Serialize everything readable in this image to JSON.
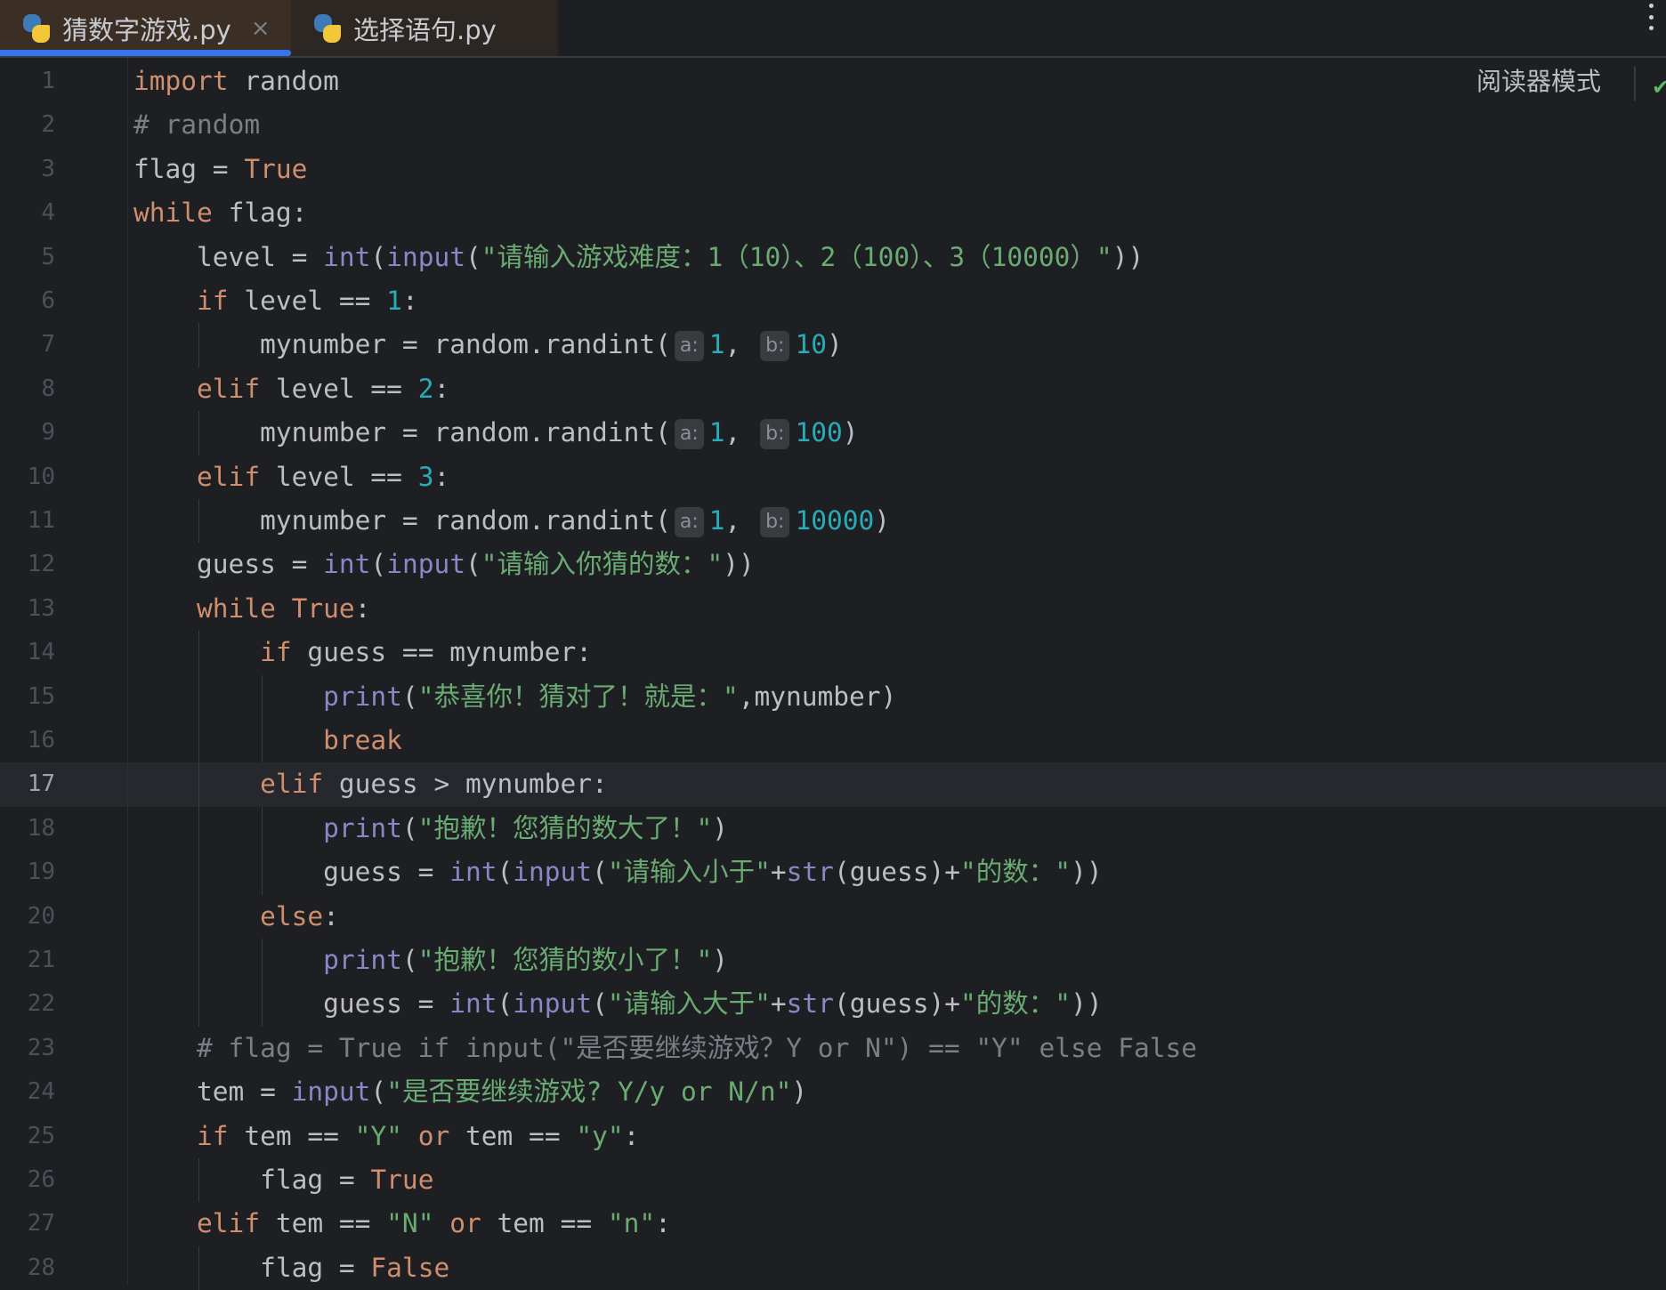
{
  "tabs": [
    {
      "label": "猜数字游戏.py",
      "active": true,
      "close": "×"
    },
    {
      "label": "选择语句.py",
      "active": false
    }
  ],
  "reader_mode": "阅读器模式",
  "current_line": 17,
  "colors": {
    "accent": "#3574F0",
    "keyword": "#CF8E6D",
    "builtin": "#8888C6",
    "string": "#6AAB73",
    "number": "#2AACB8",
    "comment": "#7A7E85"
  },
  "lines": [
    {
      "n": "1",
      "indent": 0,
      "tokens": [
        [
          "kw",
          "import"
        ],
        [
          "tx",
          " random"
        ]
      ]
    },
    {
      "n": "2",
      "indent": 0,
      "tokens": [
        [
          "cm",
          "# random"
        ]
      ]
    },
    {
      "n": "3",
      "indent": 0,
      "tokens": [
        [
          "tx",
          "flag = "
        ],
        [
          "kw",
          "True"
        ]
      ]
    },
    {
      "n": "4",
      "indent": 0,
      "tokens": [
        [
          "kw",
          "while"
        ],
        [
          "tx",
          " flag:"
        ]
      ]
    },
    {
      "n": "5",
      "indent": 1,
      "tokens": [
        [
          "tx",
          "level = "
        ],
        [
          "bi",
          "int"
        ],
        [
          "tx",
          "("
        ],
        [
          "bi",
          "input"
        ],
        [
          "tx",
          "("
        ],
        [
          "str",
          "\"请输入游戏难度：1（10）、2（100）、3（10000）\""
        ],
        [
          "tx",
          "))"
        ]
      ]
    },
    {
      "n": "6",
      "indent": 1,
      "tokens": [
        [
          "kw",
          "if"
        ],
        [
          "tx",
          " level == "
        ],
        [
          "num",
          "1"
        ],
        [
          "tx",
          ":"
        ]
      ]
    },
    {
      "n": "7",
      "indent": 2,
      "tokens": [
        [
          "tx",
          "mynumber = random.randint("
        ],
        [
          "hint",
          "a:"
        ],
        [
          "num",
          "1"
        ],
        [
          "tx",
          ", "
        ],
        [
          "hint",
          "b:"
        ],
        [
          "num",
          "10"
        ],
        [
          "tx",
          ")"
        ]
      ]
    },
    {
      "n": "8",
      "indent": 1,
      "tokens": [
        [
          "kw",
          "elif"
        ],
        [
          "tx",
          " level == "
        ],
        [
          "num",
          "2"
        ],
        [
          "tx",
          ":"
        ]
      ]
    },
    {
      "n": "9",
      "indent": 2,
      "tokens": [
        [
          "tx",
          "mynumber = random.randint("
        ],
        [
          "hint",
          "a:"
        ],
        [
          "num",
          "1"
        ],
        [
          "tx",
          ", "
        ],
        [
          "hint",
          "b:"
        ],
        [
          "num",
          "100"
        ],
        [
          "tx",
          ")"
        ]
      ]
    },
    {
      "n": "10",
      "indent": 1,
      "tokens": [
        [
          "kw",
          "elif"
        ],
        [
          "tx",
          " level == "
        ],
        [
          "num",
          "3"
        ],
        [
          "tx",
          ":"
        ]
      ]
    },
    {
      "n": "11",
      "indent": 2,
      "tokens": [
        [
          "tx",
          "mynumber = random.randint("
        ],
        [
          "hint",
          "a:"
        ],
        [
          "num",
          "1"
        ],
        [
          "tx",
          ", "
        ],
        [
          "hint",
          "b:"
        ],
        [
          "num",
          "10000"
        ],
        [
          "tx",
          ")"
        ]
      ]
    },
    {
      "n": "12",
      "indent": 1,
      "tokens": [
        [
          "tx",
          "guess = "
        ],
        [
          "bi",
          "int"
        ],
        [
          "tx",
          "("
        ],
        [
          "bi",
          "input"
        ],
        [
          "tx",
          "("
        ],
        [
          "str",
          "\"请输入你猜的数：\""
        ],
        [
          "tx",
          "))"
        ]
      ]
    },
    {
      "n": "13",
      "indent": 1,
      "tokens": [
        [
          "kw",
          "while"
        ],
        [
          "tx",
          " "
        ],
        [
          "kw",
          "True"
        ],
        [
          "tx",
          ":"
        ]
      ]
    },
    {
      "n": "14",
      "indent": 2,
      "tokens": [
        [
          "kw",
          "if"
        ],
        [
          "tx",
          " guess == mynumber:"
        ]
      ]
    },
    {
      "n": "15",
      "indent": 3,
      "tokens": [
        [
          "bi",
          "print"
        ],
        [
          "tx",
          "("
        ],
        [
          "str",
          "\"恭喜你！猜对了！就是：\""
        ],
        [
          "tx",
          ",mynumber)"
        ]
      ]
    },
    {
      "n": "16",
      "indent": 3,
      "tokens": [
        [
          "kw",
          "break"
        ]
      ]
    },
    {
      "n": "17",
      "indent": 2,
      "tokens": [
        [
          "kw",
          "elif"
        ],
        [
          "tx",
          " guess > mynumber:"
        ]
      ]
    },
    {
      "n": "18",
      "indent": 3,
      "tokens": [
        [
          "bi",
          "print"
        ],
        [
          "tx",
          "("
        ],
        [
          "str",
          "\"抱歉！您猜的数大了！\""
        ],
        [
          "tx",
          ")"
        ]
      ]
    },
    {
      "n": "19",
      "indent": 3,
      "tokens": [
        [
          "tx",
          "guess = "
        ],
        [
          "bi",
          "int"
        ],
        [
          "tx",
          "("
        ],
        [
          "bi",
          "input"
        ],
        [
          "tx",
          "("
        ],
        [
          "str",
          "\"请输入小于\""
        ],
        [
          "tx",
          "+"
        ],
        [
          "bi",
          "str"
        ],
        [
          "tx",
          "(guess)+"
        ],
        [
          "str",
          "\"的数：\""
        ],
        [
          "tx",
          "))"
        ]
      ]
    },
    {
      "n": "20",
      "indent": 2,
      "tokens": [
        [
          "kw",
          "else"
        ],
        [
          "tx",
          ":"
        ]
      ]
    },
    {
      "n": "21",
      "indent": 3,
      "tokens": [
        [
          "bi",
          "print"
        ],
        [
          "tx",
          "("
        ],
        [
          "str",
          "\"抱歉！您猜的数小了！\""
        ],
        [
          "tx",
          ")"
        ]
      ]
    },
    {
      "n": "22",
      "indent": 3,
      "tokens": [
        [
          "tx",
          "guess = "
        ],
        [
          "bi",
          "int"
        ],
        [
          "tx",
          "("
        ],
        [
          "bi",
          "input"
        ],
        [
          "tx",
          "("
        ],
        [
          "str",
          "\"请输入大于\""
        ],
        [
          "tx",
          "+"
        ],
        [
          "bi",
          "str"
        ],
        [
          "tx",
          "(guess)+"
        ],
        [
          "str",
          "\"的数：\""
        ],
        [
          "tx",
          "))"
        ]
      ]
    },
    {
      "n": "23",
      "indent": 1,
      "tokens": [
        [
          "cm",
          "# flag = True if input(\"是否要继续游戏？Y or N\") == \"Y\" else False"
        ]
      ]
    },
    {
      "n": "24",
      "indent": 1,
      "tokens": [
        [
          "tx",
          "tem = "
        ],
        [
          "bi",
          "input"
        ],
        [
          "tx",
          "("
        ],
        [
          "str",
          "\"是否要继续游戏? Y/y or N/n\""
        ],
        [
          "tx",
          ")"
        ]
      ]
    },
    {
      "n": "25",
      "indent": 1,
      "tokens": [
        [
          "kw",
          "if"
        ],
        [
          "tx",
          " tem == "
        ],
        [
          "str",
          "\"Y\""
        ],
        [
          "tx",
          " "
        ],
        [
          "kw",
          "or"
        ],
        [
          "tx",
          " tem == "
        ],
        [
          "str",
          "\"y\""
        ],
        [
          "tx",
          ":"
        ]
      ]
    },
    {
      "n": "26",
      "indent": 2,
      "tokens": [
        [
          "tx",
          "flag = "
        ],
        [
          "kw",
          "True"
        ]
      ]
    },
    {
      "n": "27",
      "indent": 1,
      "tokens": [
        [
          "kw",
          "elif"
        ],
        [
          "tx",
          " tem == "
        ],
        [
          "str",
          "\"N\""
        ],
        [
          "tx",
          " "
        ],
        [
          "kw",
          "or"
        ],
        [
          "tx",
          " tem == "
        ],
        [
          "str",
          "\"n\""
        ],
        [
          "tx",
          ":"
        ]
      ]
    },
    {
      "n": "28",
      "indent": 2,
      "tokens": [
        [
          "tx",
          "flag = "
        ],
        [
          "kw",
          "False"
        ]
      ]
    }
  ]
}
